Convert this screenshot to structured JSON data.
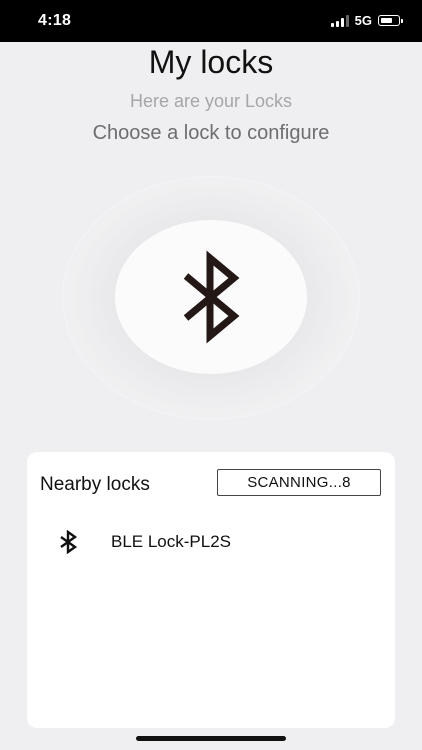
{
  "status_bar": {
    "time": "4:18",
    "network": "5G",
    "battery_level": 0.6,
    "signal_bars": 3
  },
  "header": {
    "title": "My locks",
    "subtitle": "Here are your Locks",
    "instruction": "Choose a lock to configure"
  },
  "scanner": {
    "icon": "bluetooth-icon"
  },
  "nearby": {
    "title": "Nearby locks",
    "scan_label": "SCANNING...8",
    "locks": [
      {
        "name": "BLE Lock-PL2S",
        "icon": "bluetooth-icon"
      }
    ]
  },
  "colors": {
    "background": "#efeff1",
    "status_bar": "#000000",
    "card": "#ffffff",
    "subtitle_text": "#a6a6a8",
    "instruction_text": "#6e6e70"
  }
}
